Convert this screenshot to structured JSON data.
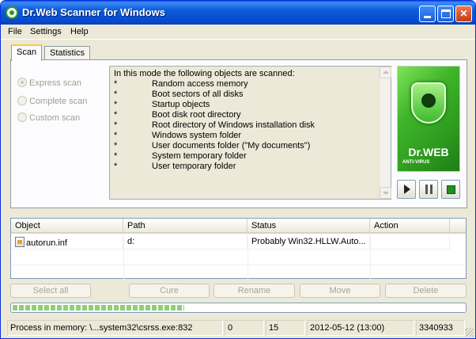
{
  "window": {
    "title": "Dr.Web Scanner for Windows",
    "controls": [
      "minimize-icon",
      "maximize-icon",
      "close-icon"
    ]
  },
  "menu": {
    "items": [
      "File",
      "Settings",
      "Help"
    ]
  },
  "tabs": {
    "items": [
      "Scan",
      "Statistics"
    ],
    "active": "Scan"
  },
  "scan_modes": {
    "selected": "Express scan",
    "enabled": false,
    "items": [
      "Express scan",
      "Complete scan",
      "Custom scan"
    ]
  },
  "info": {
    "heading": "In this mode the following objects are scanned:",
    "bullet": "*",
    "items": [
      "Random access memory",
      "Boot sectors of all disks",
      "Startup objects",
      "Boot disk root directory",
      "Root directory of Windows installation disk",
      "Windows system folder",
      "User documents folder (\"My documents\")",
      "System temporary folder",
      "User temporary folder"
    ]
  },
  "logo": {
    "name": "Dr.WEB",
    "subtitle": "ANTI-VIRUS",
    "colors": {
      "brand": "#2e9a23",
      "light": "#7ee35a"
    }
  },
  "controls": {
    "icons": [
      "play-icon",
      "pause-icon",
      "stop-icon"
    ]
  },
  "results": {
    "columns": [
      "Object",
      "Path",
      "Status",
      "Action"
    ],
    "rows": [
      {
        "object": "autorun.inf",
        "path": "d:",
        "status": "Probably Win32.HLLW.Auto...",
        "action": ""
      }
    ]
  },
  "actions": {
    "select_all": "Select all",
    "cure": "Cure",
    "rename": "Rename",
    "move": "Move",
    "delete": "Delete"
  },
  "progress": {
    "value_percent": 38
  },
  "status": {
    "process": "Process in memory: \\...system32\\csrss.exe:832",
    "threats": "0",
    "scanned": "15",
    "datetime": "2012-05-12 (13:00)",
    "count": "3340933"
  }
}
